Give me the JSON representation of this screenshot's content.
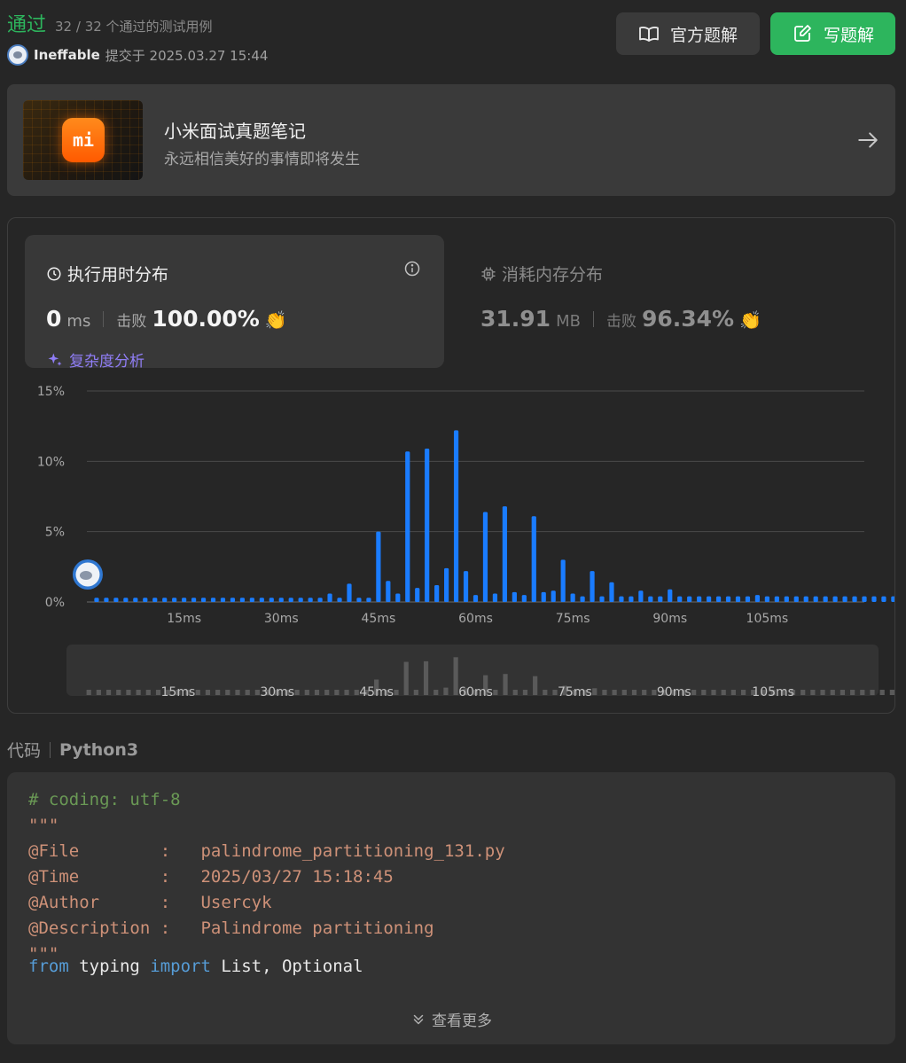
{
  "header": {
    "status": "通过",
    "tests": "32 / 32 个通过的测试用例",
    "user": "Ineffable",
    "submitted": "提交于 2025.03.27 15:44",
    "official_solution": "官方题解",
    "write_solution": "写题解"
  },
  "banner": {
    "title": "小米面试真题笔记",
    "subtitle": "永远相信美好的事情即将发生",
    "logo_text": "mi"
  },
  "runtime": {
    "title": "执行用时分布",
    "value": "0",
    "unit": "ms",
    "beat_label": "击败",
    "beat": "100.00%",
    "complexity": "复杂度分析"
  },
  "memory": {
    "title": "消耗内存分布",
    "value": "31.91",
    "unit": "MB",
    "beat_label": "击败",
    "beat": "96.34%"
  },
  "chart_data": {
    "type": "bar",
    "title": "",
    "xlabel": "",
    "ylabel": "",
    "ylim": [
      0,
      15
    ],
    "y_ticks": [
      "0%",
      "5%",
      "10%",
      "15%"
    ],
    "x_ticks": [
      "15ms",
      "30ms",
      "45ms",
      "60ms",
      "75ms",
      "90ms",
      "105ms"
    ],
    "x_tick_values": [
      15,
      30,
      45,
      60,
      75,
      90,
      105
    ],
    "bin_ms": 1.5,
    "first_bin_ms": 1.5,
    "values": [
      0.3,
      0.3,
      0.3,
      0.3,
      0.3,
      0.3,
      0.3,
      0.3,
      0.3,
      0.3,
      0.3,
      0.3,
      0.3,
      0.3,
      0.3,
      0.3,
      0.3,
      0.3,
      0.3,
      0.3,
      0.3,
      0.3,
      0.3,
      0.3,
      0.6,
      0.3,
      1.3,
      0.3,
      0.3,
      5.0,
      1.5,
      0.6,
      10.7,
      1.0,
      10.9,
      1.2,
      2.4,
      12.2,
      2.2,
      0.5,
      6.4,
      0.6,
      6.8,
      0.7,
      0.5,
      6.1,
      0.7,
      0.8,
      3.0,
      0.6,
      0.4,
      2.2,
      0.4,
      1.4,
      0.4,
      0.4,
      0.8,
      0.4,
      0.4,
      0.9,
      0.4,
      0.4,
      0.4,
      0.4,
      0.4,
      0.4,
      0.4,
      0.4,
      0.5,
      0.4,
      0.4,
      0.4,
      0.4,
      0.4,
      0.4,
      0.4,
      0.4,
      0.4,
      0.4,
      0.4,
      0.4,
      0.4,
      0.4,
      0.4
    ],
    "user_bin_index": 0,
    "grid": true
  },
  "code": {
    "label": "代码",
    "language": "Python3",
    "lines": [
      {
        "cls": "c-comment",
        "text": "# coding: utf-8"
      },
      {
        "cls": "c-str",
        "text": "\"\"\""
      },
      {
        "cls": "c-str",
        "text": "@File        :   palindrome_partitioning_131.py"
      },
      {
        "cls": "c-str",
        "text": "@Time        :   2025/03/27 15:18:45"
      },
      {
        "cls": "c-str",
        "text": "@Author      :   Usercyk"
      },
      {
        "cls": "c-str",
        "text": "@Description :   Palindrome partitioning"
      },
      {
        "cls": "c-str",
        "text": "\"\"\""
      }
    ],
    "last_line": {
      "kw1": "from",
      "mod": " typing ",
      "kw2": "import",
      "names": " List, Optional"
    },
    "more": "查看更多"
  },
  "colors": {
    "accent_green": "#2db55d",
    "bar_blue": "#1a7cff",
    "minimap_bar": "#5a5a5a",
    "complexity_purple": "#8f7df5"
  },
  "icons": [
    "book-icon",
    "edit-icon",
    "arrow-right-icon",
    "clock-icon",
    "info-icon",
    "chip-icon",
    "clap-icon",
    "sparkle-icon",
    "chevron-double-down-icon"
  ]
}
